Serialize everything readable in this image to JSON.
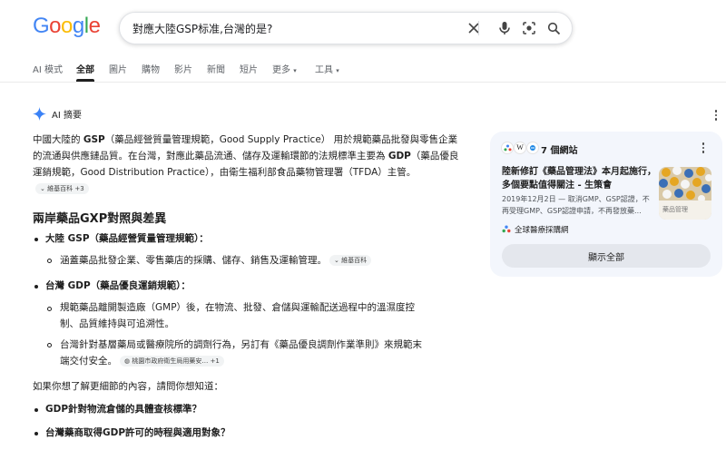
{
  "logo": {
    "text": "Google"
  },
  "search": {
    "query": "對應大陸GSP标准,台灣的是?"
  },
  "tabs": [
    "AI 模式",
    "全部",
    "圖片",
    "購物",
    "影片",
    "新聞",
    "短片",
    "更多",
    "工具"
  ],
  "ai_overview": {
    "header": "AI 摘要",
    "intro": {
      "part1": "中國大陸的 ",
      "gsp": "GSP",
      "part2": "（藥品經營質量管理規範，Good Supply Practice） 用於規範藥品批發與零售企業的流通與供應鏈品質。在台灣，對應此藥品流通、儲存及運輸環節的法規標準主要為 ",
      "gdp": "GDP",
      "part3": "（藥品優良運銷規範，Good Distribution Practice），由衛生福利部食品藥物管理署（TFDA）主管。",
      "chip": "維基百科 +3"
    },
    "heading": "兩岸藥品GXP對照與差異",
    "mainland_title": "大陸 GSP（藥品經營質量管理規範）：",
    "mainland_sub": "涵蓋藥品批發企業、零售藥店的採購、儲存、銷售及運輸管理。",
    "mainland_chip": "維基百科",
    "taiwan_title": "台灣 GDP（藥品優良運銷規範）：",
    "taiwan_sub1_l1": "規範藥品離開製造廠（GMP）後，在物流、批發、倉儲與運輸配送過程中的溫濕度控",
    "taiwan_sub1_l2": "制、品質維持與可追溯性。",
    "taiwan_sub2_l1": "台灣針對基層藥局或醫療院所的調劑行為，另訂有《藥品優良調劑作業準則》來規範末",
    "taiwan_sub2_l2": "端交付安全。",
    "taiwan_chip": "桃園市政府衛生局用藥安… +1",
    "followup_intro": "如果你想了解更細節的內容，請問你想知道：",
    "q1": "GDP針對物流倉儲的具體查核標準？",
    "q2": "台灣藥商取得GDP許可的時程與適用對象？"
  },
  "sources_card": {
    "count_label": "7 個網站",
    "article_title": "陸新修訂《藥品管理法》本月起施行，多個要點值得關注 - 生策會",
    "article_snippet": "2019年12月2日 — 取消GMP、GSP認證，不再受理GMP、GSP認證申請，不再發放藥...",
    "thumb_text": "藥品管理",
    "source_name": "全球醫療採購網",
    "show_all": "顯示全部"
  },
  "colors": {
    "blue": "#4285F4",
    "red": "#EA4335",
    "yellow": "#FBBC05",
    "green": "#34A853",
    "accent": "#1a73e8"
  }
}
